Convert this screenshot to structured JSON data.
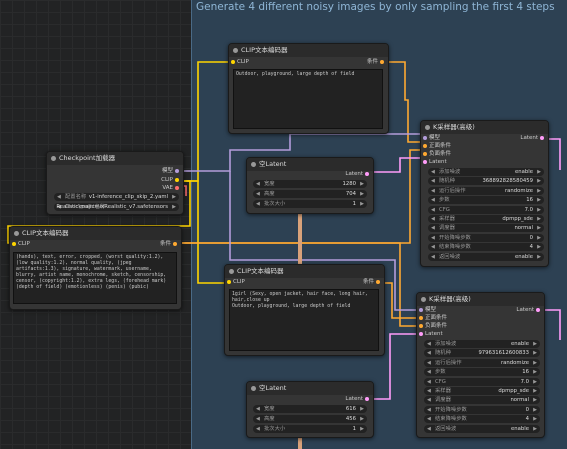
{
  "group": {
    "title": "Generate 4 different noisy images by only sampling the first 4 steps"
  },
  "colors": {
    "clip": "#ffd500",
    "conditioning": "#ffa931",
    "latent": "#ff9cf9",
    "model": "#b39ddb",
    "vae": "#ff6e6e"
  },
  "checkpoint": {
    "title": "Checkpoint加载器",
    "outputs": [
      "模型",
      "CLIP",
      "VAE"
    ],
    "widgets": [
      {
        "label": "配置名称",
        "value": "v1-inference_clip_skip_2.yaml"
      },
      {
        "label": "Checkpoint名称",
        "value": "Realistic\\majicmixRealistic_v7.safetensors"
      }
    ]
  },
  "clip_left": {
    "title": "CLIP文本编码器",
    "input": "CLIP",
    "output": "条件",
    "text": "(hands), text, error, cropped, (worst quality:1.2), (low quality:1.2), normal quality, (jpeg artifacts:1.3), signature, watermark, username, blurry, artist name, monochrome, sketch, censorship, censor, (copyright:1.2), extra legs, (forehead mark) (depth of field) (emotionless) (penis) (pubic)"
  },
  "clip_top": {
    "title": "CLIP文本编码器",
    "input": "CLIP",
    "output": "条件",
    "text": "Outdoor, playground, large depth of field"
  },
  "clip_mid": {
    "title": "CLIP文本编码器",
    "input": "CLIP",
    "output": "条件",
    "text": "1girl (Sexy, open jacket, hair face, long hair, hair,close up\nOutdoor, playground, large depth of field"
  },
  "latent_top": {
    "title": "空Latent",
    "output": "Latent",
    "widgets": [
      {
        "label": "宽度",
        "value": "1280"
      },
      {
        "label": "高度",
        "value": "704"
      },
      {
        "label": "批次大小",
        "value": "1"
      }
    ]
  },
  "latent_bot": {
    "title": "空Latent",
    "output": "Latent",
    "widgets": [
      {
        "label": "宽度",
        "value": "616"
      },
      {
        "label": "高度",
        "value": "456"
      },
      {
        "label": "批次大小",
        "value": "1"
      }
    ]
  },
  "ksampler_top": {
    "title": "K采样器(高级)",
    "inputs": [
      "模型",
      "正面条件",
      "负面条件",
      "Latent"
    ],
    "output": "Latent",
    "widgets": [
      {
        "label": "添加噪波",
        "value": "enable"
      },
      {
        "label": "随机种",
        "value": "368892828580459"
      },
      {
        "label": "运行后操作",
        "value": "randomize"
      },
      {
        "label": "步数",
        "value": "16"
      },
      {
        "label": "CFG",
        "value": "7.0"
      },
      {
        "label": "采样器",
        "value": "dpmpp_sde"
      },
      {
        "label": "调度器",
        "value": "normal"
      },
      {
        "label": "开始降噪步数",
        "value": "0"
      },
      {
        "label": "结束降噪步数",
        "value": "4"
      },
      {
        "label": "返回噪波",
        "value": "enable"
      }
    ]
  },
  "ksampler_bot": {
    "title": "K采样器(高级)",
    "inputs": [
      "模型",
      "正面条件",
      "负面条件",
      "Latent"
    ],
    "output": "Latent",
    "widgets": [
      {
        "label": "添加噪波",
        "value": "enable"
      },
      {
        "label": "随机种",
        "value": "979631612600833"
      },
      {
        "label": "运行后操作",
        "value": "randomize"
      },
      {
        "label": "步数",
        "value": "16"
      },
      {
        "label": "CFG",
        "value": "7.0"
      },
      {
        "label": "采样器",
        "value": "dpmpp_sde"
      },
      {
        "label": "调度器",
        "value": "normal"
      },
      {
        "label": "开始降噪步数",
        "value": "0"
      },
      {
        "label": "结束降噪步数",
        "value": "4"
      },
      {
        "label": "返回噪波",
        "value": "enable"
      }
    ]
  }
}
